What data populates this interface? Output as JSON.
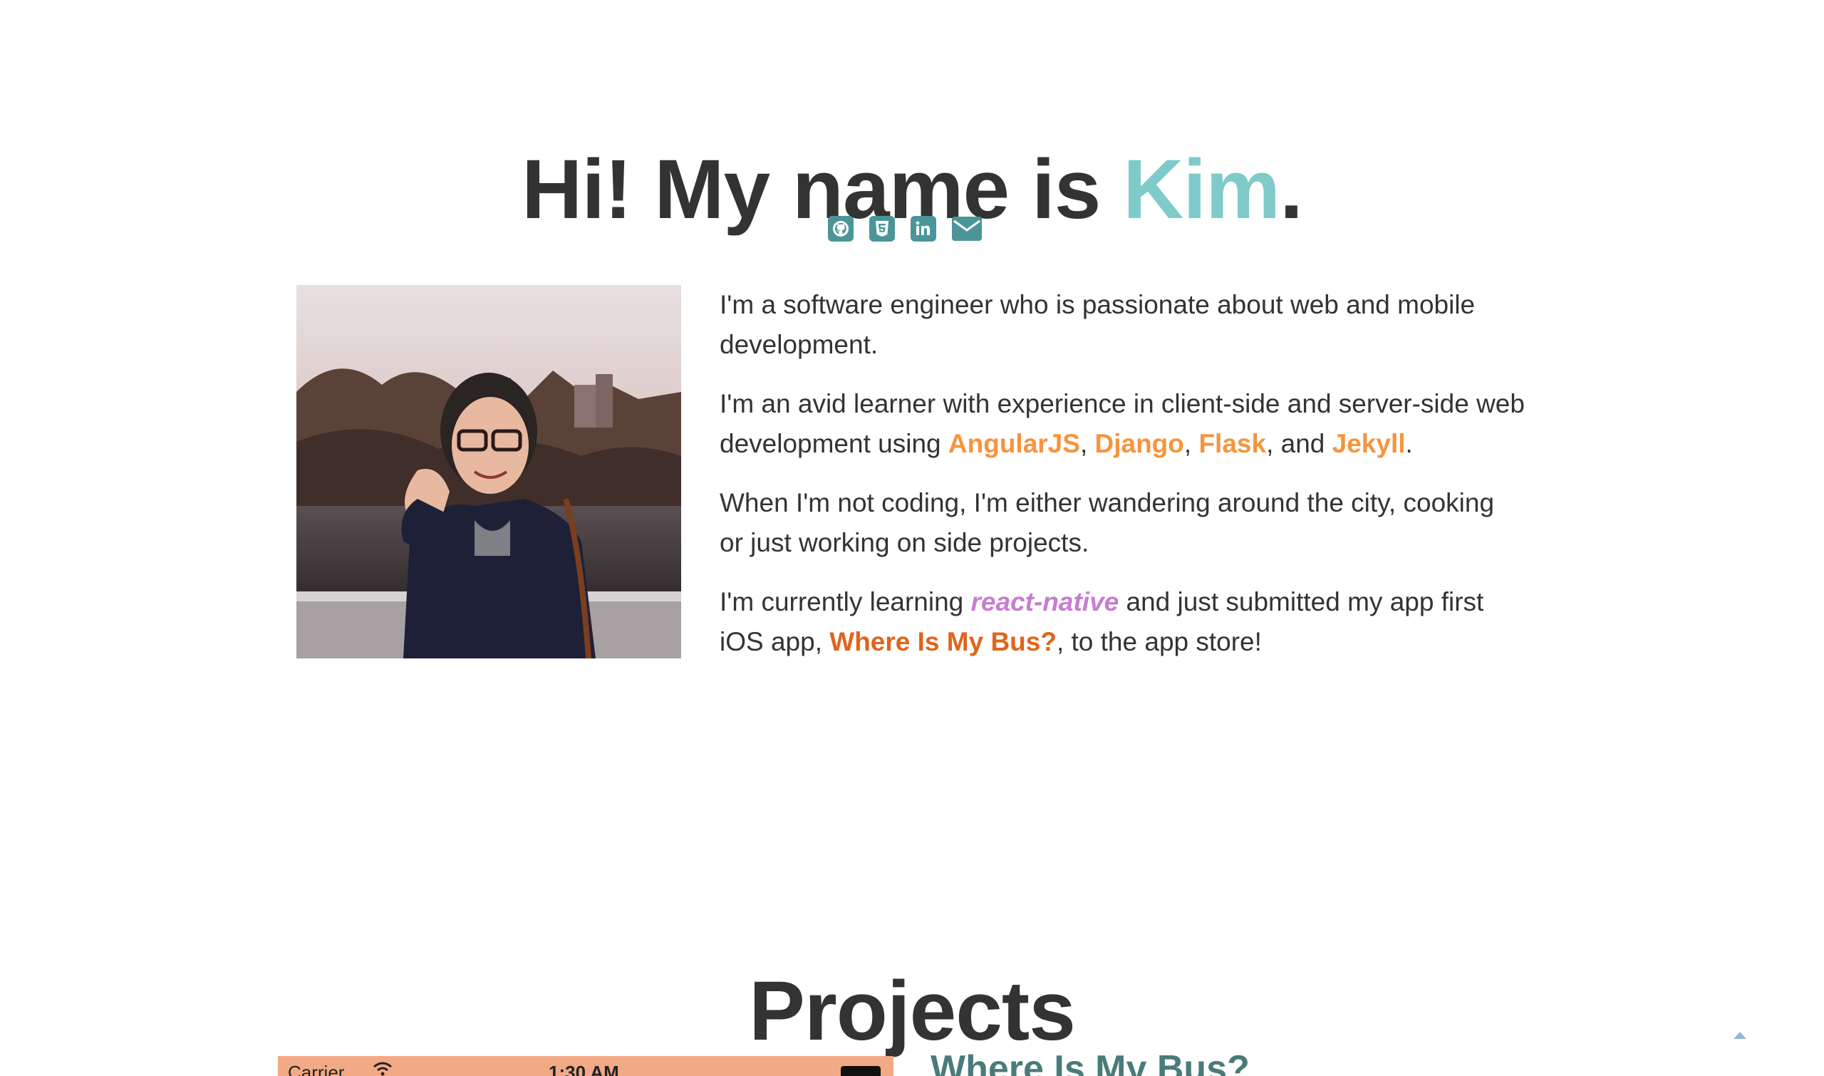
{
  "hero": {
    "greeting": "Hi! My name is ",
    "name": "Kim",
    "period": "."
  },
  "social": [
    {
      "icon": "github-icon"
    },
    {
      "icon": "html5-icon"
    },
    {
      "icon": "linkedin-icon"
    },
    {
      "icon": "envelope-icon"
    }
  ],
  "bio": {
    "p1": "I'm a software engineer who is passionate about web and mobile development.",
    "p2_start": "I'm an avid learner with experience in client-side and server-side web development using ",
    "tech": [
      "AngularJS",
      "Django",
      "Flask",
      "Jekyll"
    ],
    "sep_comma": ", ",
    "sep_and": ", and ",
    "p2_end": ".",
    "p3": "When I'm not coding, I'm either wandering around the city, cooking or just working on side projects.",
    "p4_start": "I'm currently learning ",
    "p4_rn": "react-native",
    "p4_mid": " and just submitted my app first iOS app, ",
    "p4_app": "Where Is My Bus?",
    "p4_end": ", to the app store!"
  },
  "projects": {
    "title": "Projects",
    "phone": {
      "carrier": "Carrier",
      "time": "1:30 AM"
    },
    "first_project_name": "Where Is My Bus?"
  },
  "colors": {
    "accent_teal": "#7ecbc9",
    "icon_teal": "#4b9598",
    "link_orange": "#f7943c",
    "link_purple": "#c77dd1",
    "link_dark_orange": "#e0641b",
    "project_heading": "#4a7b7a"
  }
}
